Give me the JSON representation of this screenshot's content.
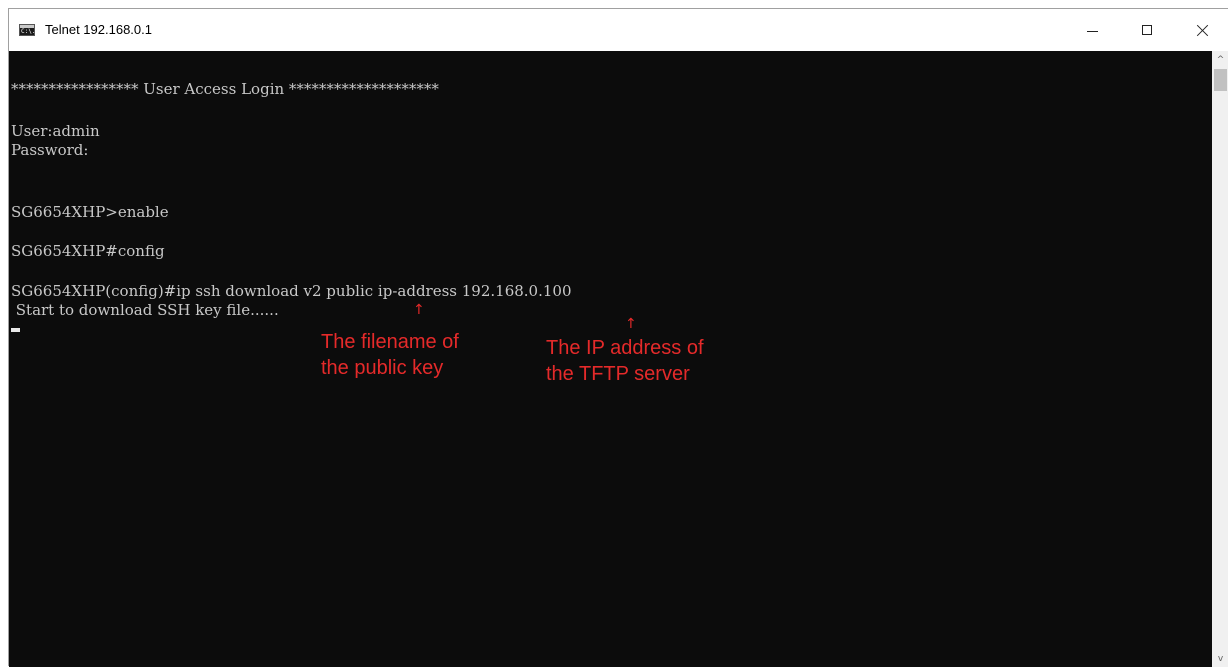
{
  "window": {
    "title": "Telnet 192.168.0.1",
    "icon": "console-icon",
    "icon_text": "C:\\."
  },
  "terminal": {
    "lines": [
      "***************** User Access Login ********************",
      "User:admin",
      "Password:",
      "SG6654XHP>enable",
      "SG6654XHP#config",
      "SG6654XHP(config)#ip ssh download v2 public ip-address 192.168.0.100",
      " Start to download SSH key file......"
    ]
  },
  "annotations": {
    "arrow_glyph": "↑",
    "filename_note": "The filename of\nthe public key",
    "ip_note": "The IP address of\nthe TFTP server",
    "color": "#e52a2a"
  },
  "scrollbar": {
    "up_glyph": "^",
    "down_glyph": "v"
  }
}
